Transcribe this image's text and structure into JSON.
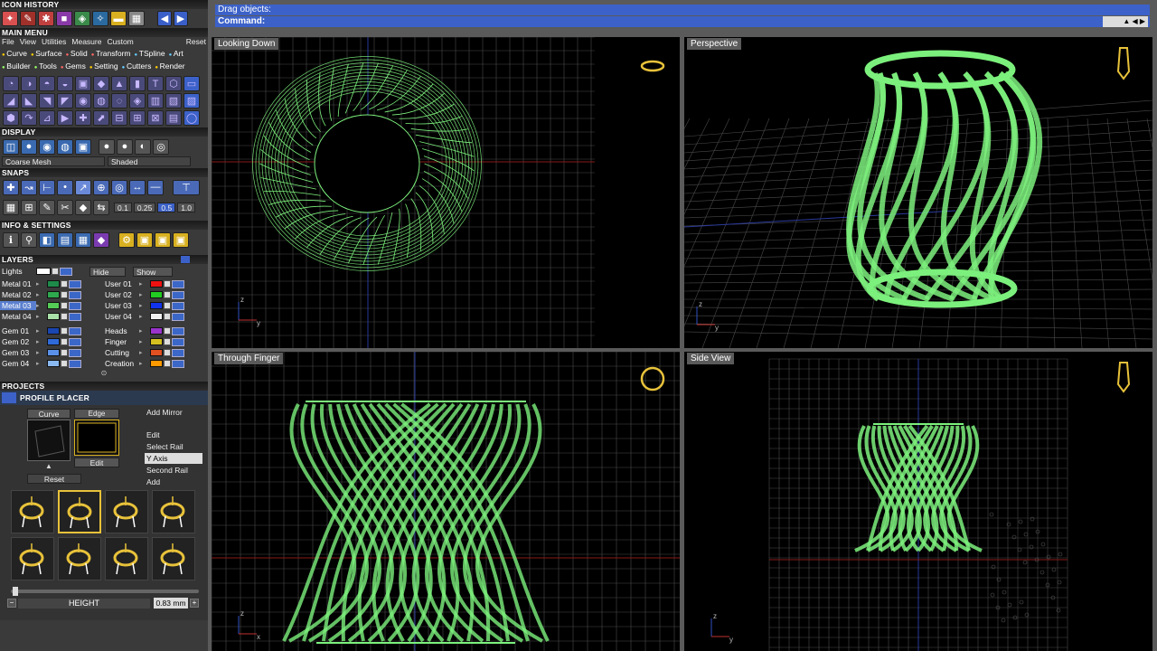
{
  "left_panel": {
    "icon_history_title": "ICON HISTORY",
    "main_menu_title": "MAIN MENU",
    "menu_items": [
      "File",
      "View",
      "Utilities",
      "Measure",
      "Custom",
      "Reset"
    ],
    "categories": [
      {
        "label": "Curve",
        "color": "c1"
      },
      {
        "label": "Surface",
        "color": "c1"
      },
      {
        "label": "Solid",
        "color": "c2"
      },
      {
        "label": "Transform",
        "color": "c2"
      },
      {
        "label": "TSpline",
        "color": "c3"
      },
      {
        "label": "Art",
        "color": "c3"
      },
      {
        "label": "Builder",
        "color": "c4"
      },
      {
        "label": "Tools",
        "color": "c4"
      },
      {
        "label": "Gems",
        "color": "c2"
      },
      {
        "label": "Setting",
        "color": "c1"
      },
      {
        "label": "Cutters",
        "color": "c3"
      },
      {
        "label": "Render",
        "color": "c1"
      }
    ],
    "display_title": "DISPLAY",
    "display_mesh": "Coarse Mesh",
    "display_mode": "Shaded",
    "snaps_title": "SNAPS",
    "snap_values": [
      "0.1",
      "0.25",
      "0.5",
      "1.0"
    ],
    "info_title": "INFO & SETTINGS",
    "layers_title": "LAYERS",
    "lights_label": "Lights",
    "hide_label": "Hide",
    "show_label": "Show",
    "layers_left": [
      {
        "name": "Metal 01",
        "color": "#1e8a4a",
        "selected": false
      },
      {
        "name": "Metal 02",
        "color": "#2ea84e",
        "selected": false
      },
      {
        "name": "Metal 03",
        "color": "#55cc55",
        "selected": true
      },
      {
        "name": "Metal 04",
        "color": "#a8e0a8",
        "selected": false
      },
      {
        "name": "Gem 01",
        "color": "#1a46b0",
        "selected": false
      },
      {
        "name": "Gem 02",
        "color": "#2e6ad8",
        "selected": false
      },
      {
        "name": "Gem 03",
        "color": "#5a90e8",
        "selected": false
      },
      {
        "name": "Gem 04",
        "color": "#8ab8f0",
        "selected": false
      }
    ],
    "layers_right": [
      {
        "name": "User 01",
        "color": "#ee1111"
      },
      {
        "name": "User 02",
        "color": "#22cc22"
      },
      {
        "name": "User 03",
        "color": "#1133ee"
      },
      {
        "name": "User 04",
        "color": "#f0f0f0"
      },
      {
        "name": "Heads",
        "color": "#9933cc"
      },
      {
        "name": "Finger",
        "color": "#d4c020"
      },
      {
        "name": "Cutting",
        "color": "#e05020"
      },
      {
        "name": "Creation",
        "color": "#ff9900"
      }
    ],
    "projects_title": "PROJECTS",
    "profile_placer_title": "PROFILE PLACER",
    "curve_label": "Curve",
    "edge_profile_label": "Edge Profile",
    "edit_label": "Edit",
    "reset_label": "Reset",
    "options": [
      "Add Mirror",
      "Edit",
      "Select Rail",
      "Y Axis",
      "Second Rail",
      "Add"
    ],
    "height_label": "HEIGHT",
    "height_value": "0.83 mm"
  },
  "command_area": {
    "line1": "Drag objects:",
    "line2": "Command:"
  },
  "viewports": {
    "top_left": "Looking Down",
    "top_right": "Perspective",
    "bottom_left": "Through Finger",
    "bottom_right": "Side View"
  },
  "colors": {
    "wire": "#7cf07c",
    "grid": "#4a4a4a",
    "cmd_blue": "#3c62c9",
    "accent": "#e8c23a"
  }
}
